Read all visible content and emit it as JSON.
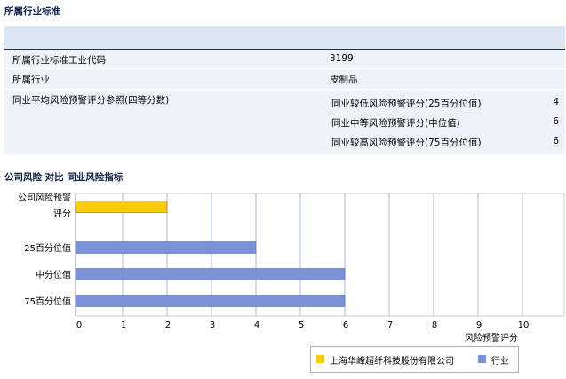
{
  "section1": {
    "title": "所属行业标准",
    "rows": [
      {
        "label": "所属行业标准工业代码",
        "value": "3199"
      },
      {
        "label": "所属行业",
        "value": "皮制品"
      },
      {
        "label": "同业平均风险预警评分参照(四等分数)"
      }
    ],
    "quartiles": [
      {
        "label": "同业较低风险预警评分(25百分位值)",
        "value": "4"
      },
      {
        "label": "同业中等风险预警评分(中位值)",
        "value": "6"
      },
      {
        "label": "同业较高风险预警评分(75百分位值)",
        "value": "6"
      }
    ]
  },
  "section2": {
    "title": "公司风险 对比 同业风险指标"
  },
  "chart_data": {
    "type": "bar",
    "orientation": "horizontal",
    "categories": [
      "公司风险预警评分",
      "25百分位值",
      "中分位值",
      "75百分位值"
    ],
    "category_lines": [
      [
        "公司风险预警",
        "评分"
      ],
      [
        "25百分位值"
      ],
      [
        "中分位值"
      ],
      [
        "75百分位值"
      ]
    ],
    "values": [
      2,
      4,
      6,
      6
    ],
    "bar_series": [
      "company",
      "industry",
      "industry",
      "industry"
    ],
    "series": [
      {
        "key": "company",
        "name": "上海华峰超纤科技股份有限公司",
        "color": "#ffcc00"
      },
      {
        "key": "industry",
        "name": "行业",
        "color": "#7b92d6"
      }
    ],
    "xlabel": "风险预警评分",
    "ylabel": "",
    "xlim": [
      0,
      10
    ],
    "xticks": [
      0,
      1,
      2,
      3,
      4,
      5,
      6,
      7,
      8,
      9,
      10
    ],
    "grid": true,
    "legend_position": "bottom-right"
  }
}
